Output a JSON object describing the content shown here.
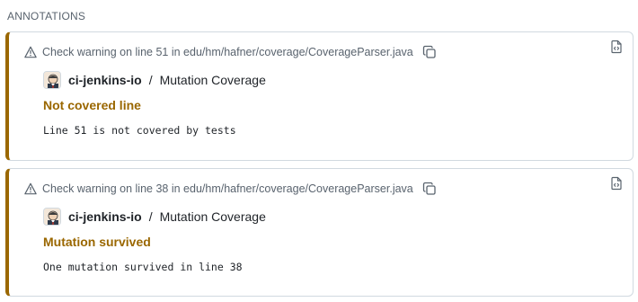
{
  "section_title": "ANNOTATIONS",
  "annotations": [
    {
      "location": "Check warning on line 51 in edu/hm/hafner/coverage/CoverageParser.java",
      "app_name": "ci-jenkins-io",
      "separator": "/",
      "check_name": "Mutation Coverage",
      "title": "Not covered line",
      "message": "Line 51 is not covered by tests"
    },
    {
      "location": "Check warning on line 38 in edu/hm/hafner/coverage/CoverageParser.java",
      "app_name": "ci-jenkins-io",
      "separator": "/",
      "check_name": "Mutation Coverage",
      "title": "Mutation survived",
      "message": "One mutation survived in line 38"
    }
  ],
  "icons": {
    "warning": "alert-triangle-icon",
    "copy": "copy-icon",
    "raw": "file-code-icon"
  },
  "colors": {
    "warning_accent": "#9a6700",
    "border": "#d1d9e0",
    "muted_text": "#59636e"
  }
}
